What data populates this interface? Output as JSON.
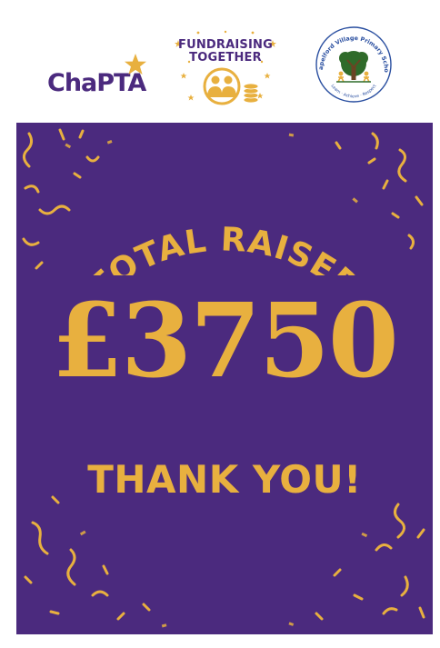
{
  "logos": {
    "chapta": {
      "text": "ChaPTA",
      "icon": "star-icon"
    },
    "fundraising": {
      "line1": "FUNDRAISING",
      "line2": "TOGETHER",
      "icon": "people-coins-icon"
    },
    "school": {
      "name": "Chapelford Village Primary School",
      "motto": "Learn · Achieve · Respect",
      "icon": "tree-children-icon"
    }
  },
  "poster": {
    "heading": "TOTAL RAISED",
    "amount": "£3750",
    "thanks": "THANK YOU!"
  },
  "colors": {
    "purple": "#4b2a7e",
    "gold": "#e8b03f",
    "green": "#2f6b2a"
  }
}
